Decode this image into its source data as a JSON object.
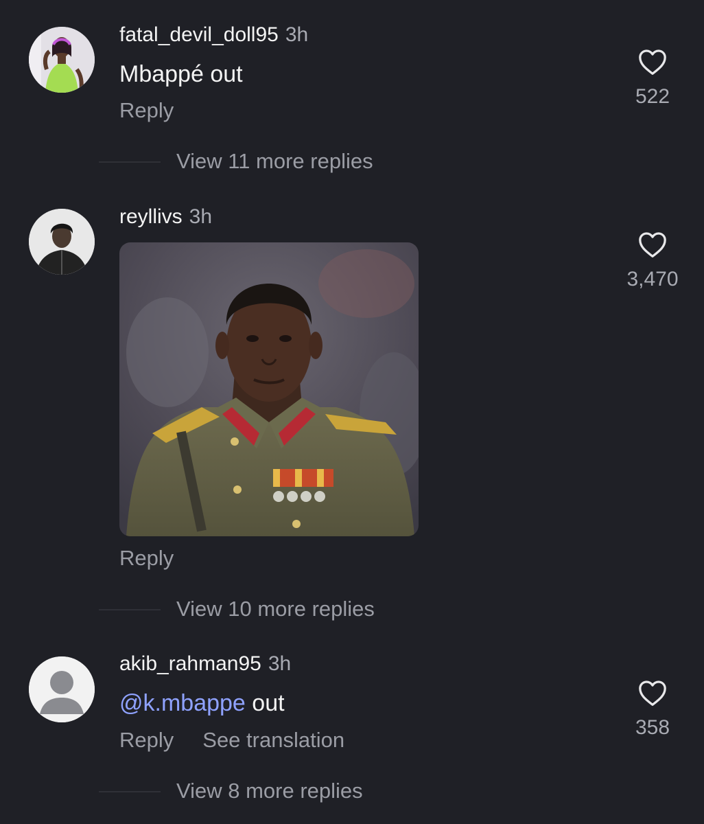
{
  "comments": [
    {
      "username": "fatal_devil_doll95",
      "time": "3h",
      "text": "Mbappé out",
      "reply_label": "Reply",
      "likes": "522",
      "view_replies": "View 11 more replies"
    },
    {
      "username": "reyllivs",
      "time": "3h",
      "reply_label": "Reply",
      "likes": "3,470",
      "view_replies": "View 10 more replies"
    },
    {
      "username": "akib_rahman95",
      "time": "3h",
      "mention": "@k.mbappe",
      "text": " out",
      "reply_label": "Reply",
      "translate_label": "See translation",
      "likes": "358",
      "view_replies": "View 8 more replies"
    }
  ],
  "colors": {
    "background": "#1f2026",
    "mention": "#8fa2ff",
    "muted": "#9b9da5"
  },
  "icons": [
    "heart-icon",
    "default-avatar-icon"
  ]
}
